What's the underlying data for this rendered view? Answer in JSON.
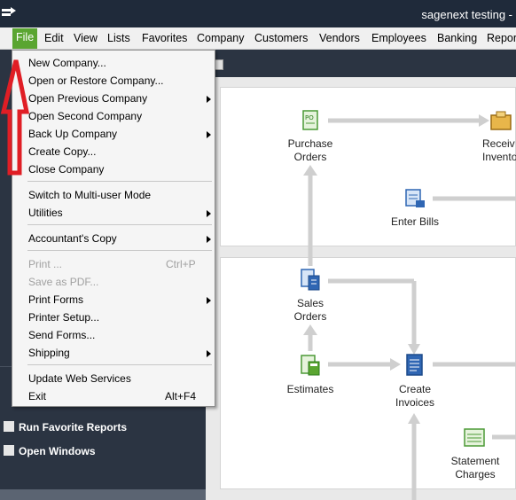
{
  "window": {
    "title": "sagenext testing -"
  },
  "menubar": {
    "items": [
      {
        "label": "File",
        "active": true
      },
      {
        "label": "Edit"
      },
      {
        "label": "View"
      },
      {
        "label": "Lists"
      },
      {
        "label": "Favorites"
      },
      {
        "label": "Company"
      },
      {
        "label": "Customers"
      },
      {
        "label": "Vendors"
      },
      {
        "label": "Employees"
      },
      {
        "label": "Banking"
      },
      {
        "label": "Repor"
      }
    ]
  },
  "file_menu": {
    "items": [
      {
        "label": "New Company..."
      },
      {
        "label": "Open or Restore Company..."
      },
      {
        "label": "Open Previous Company",
        "submenu": true
      },
      {
        "label": "Open Second Company"
      },
      {
        "label": "Back Up Company",
        "submenu": true
      },
      {
        "label": "Create Copy..."
      },
      {
        "label": "Close Company"
      },
      {
        "label": "Switch to Multi-user Mode"
      },
      {
        "label": "Utilities",
        "submenu": true
      },
      {
        "label": "Accountant's Copy",
        "submenu": true
      },
      {
        "label": "Print ...",
        "disabled": true,
        "shortcut": "Ctrl+P"
      },
      {
        "label": "Save as PDF...",
        "disabled": true
      },
      {
        "label": "Print Forms",
        "submenu": true
      },
      {
        "label": "Printer Setup..."
      },
      {
        "label": "Send Forms..."
      },
      {
        "label": "Shipping",
        "submenu": true
      },
      {
        "label": "Update Web Services"
      },
      {
        "label": "Exit",
        "shortcut": "Alt+F4"
      }
    ]
  },
  "left_nav": {
    "items": [
      {
        "label": "Run Favorite Reports",
        "icon": "reports-icon"
      },
      {
        "label": "Open Windows",
        "icon": "windows-icon"
      }
    ]
  },
  "workflow": {
    "purchase_orders": "Purchase\nOrders",
    "receive_inventory": "Receiv\nInvento",
    "enter_bills": "Enter Bills",
    "sales_orders": "Sales\nOrders",
    "estimates": "Estimates",
    "create_invoices": "Create\nInvoices",
    "statement_charges": "Statement\nCharges"
  },
  "colors": {
    "title_bar": "#1f2a3a",
    "file_active": "#5aa531",
    "left_panel": "#2b3442",
    "annotation_arrow": "#e01e25"
  }
}
